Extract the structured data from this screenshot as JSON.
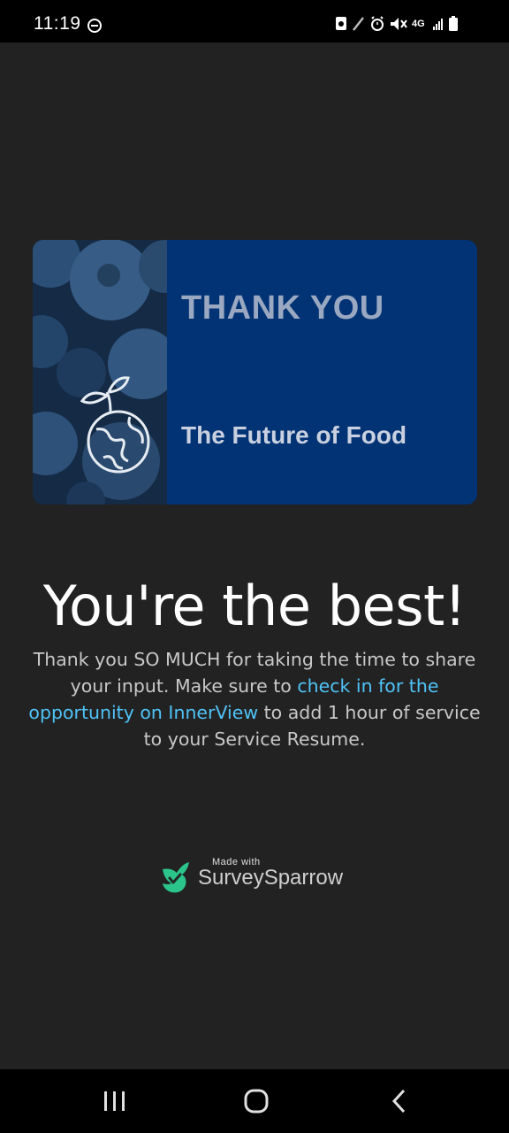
{
  "status_bar": {
    "time": "11:19",
    "network_label": "4G"
  },
  "card": {
    "title": "THANK YOU",
    "subtitle": "The Future of Food",
    "accent_color": "#023374"
  },
  "thank_you": {
    "heading": "You're the best!",
    "body_part1": "Thank you SO MUCH for taking the time to share your input. Make sure to ",
    "link_text": "check in for the opportunity on InnerView",
    "body_part2": " to add 1 hour of service to your Service Resume.",
    "link_color": "#4fc3f7"
  },
  "branding": {
    "made_with": "Made with",
    "brand_name": "SurveySparrow",
    "icon": "sparrow-logo-icon",
    "brand_color": "#2bc48a"
  },
  "nav_bar": {
    "recent_icon": "recent-apps-icon",
    "home_icon": "home-icon",
    "back_icon": "back-icon"
  }
}
